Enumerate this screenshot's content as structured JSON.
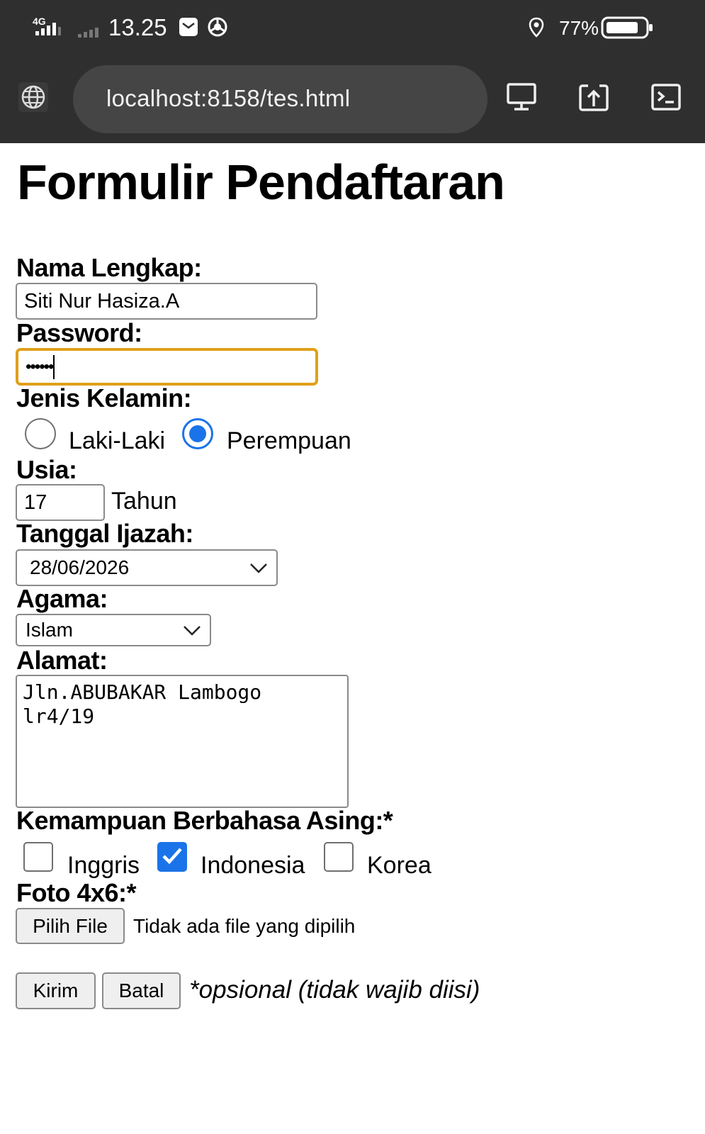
{
  "status_bar": {
    "network": "4G",
    "time": "13.25",
    "battery": "77%",
    "icons": [
      "signal-4g-icon",
      "signal-icon",
      "mail-icon",
      "chrome-icon",
      "location-icon",
      "battery-icon"
    ]
  },
  "browser": {
    "url": "localhost:8158/tes.html",
    "icons": [
      "globe-icon",
      "desktop-icon",
      "upload-icon",
      "terminal-icon"
    ]
  },
  "form": {
    "title": "Formulir Pendaftaran",
    "nama_label": "Nama Lengkap:",
    "nama_value": "Siti Nur Hasiza.A",
    "password_label": "Password:",
    "password_value": "••••••",
    "gender_label": "Jenis Kelamin:",
    "gender_options": [
      "Laki-Laki",
      "Perempuan"
    ],
    "gender_selected": "Perempuan",
    "usia_label": "Usia:",
    "usia_value": "17",
    "usia_unit": "Tahun",
    "tanggal_label": "Tanggal Ijazah:",
    "tanggal_value": "28/06/2026",
    "agama_label": "Agama:",
    "agama_value": "Islam",
    "alamat_label": "Alamat:",
    "alamat_value": "Jln.ABUBAKAR Lambogo\nlr4/19",
    "bahasa_label": "Kemampuan Berbahasa Asing:*",
    "bahasa_options": [
      "Inggris",
      "Indonesia",
      "Korea"
    ],
    "bahasa_checked": [
      "Indonesia"
    ],
    "foto_label": "Foto 4x6:*",
    "file_button": "Pilih File",
    "file_status": "Tidak ada file yang dipilih",
    "submit_button": "Kirim",
    "cancel_button": "Batal",
    "note": "*opsional (tidak wajib diisi)"
  },
  "colors": {
    "browser_chrome": "#2f2f2f",
    "url_bar": "#454545",
    "accent": "#1a73e8",
    "focus_ring": "#e0a01a"
  }
}
